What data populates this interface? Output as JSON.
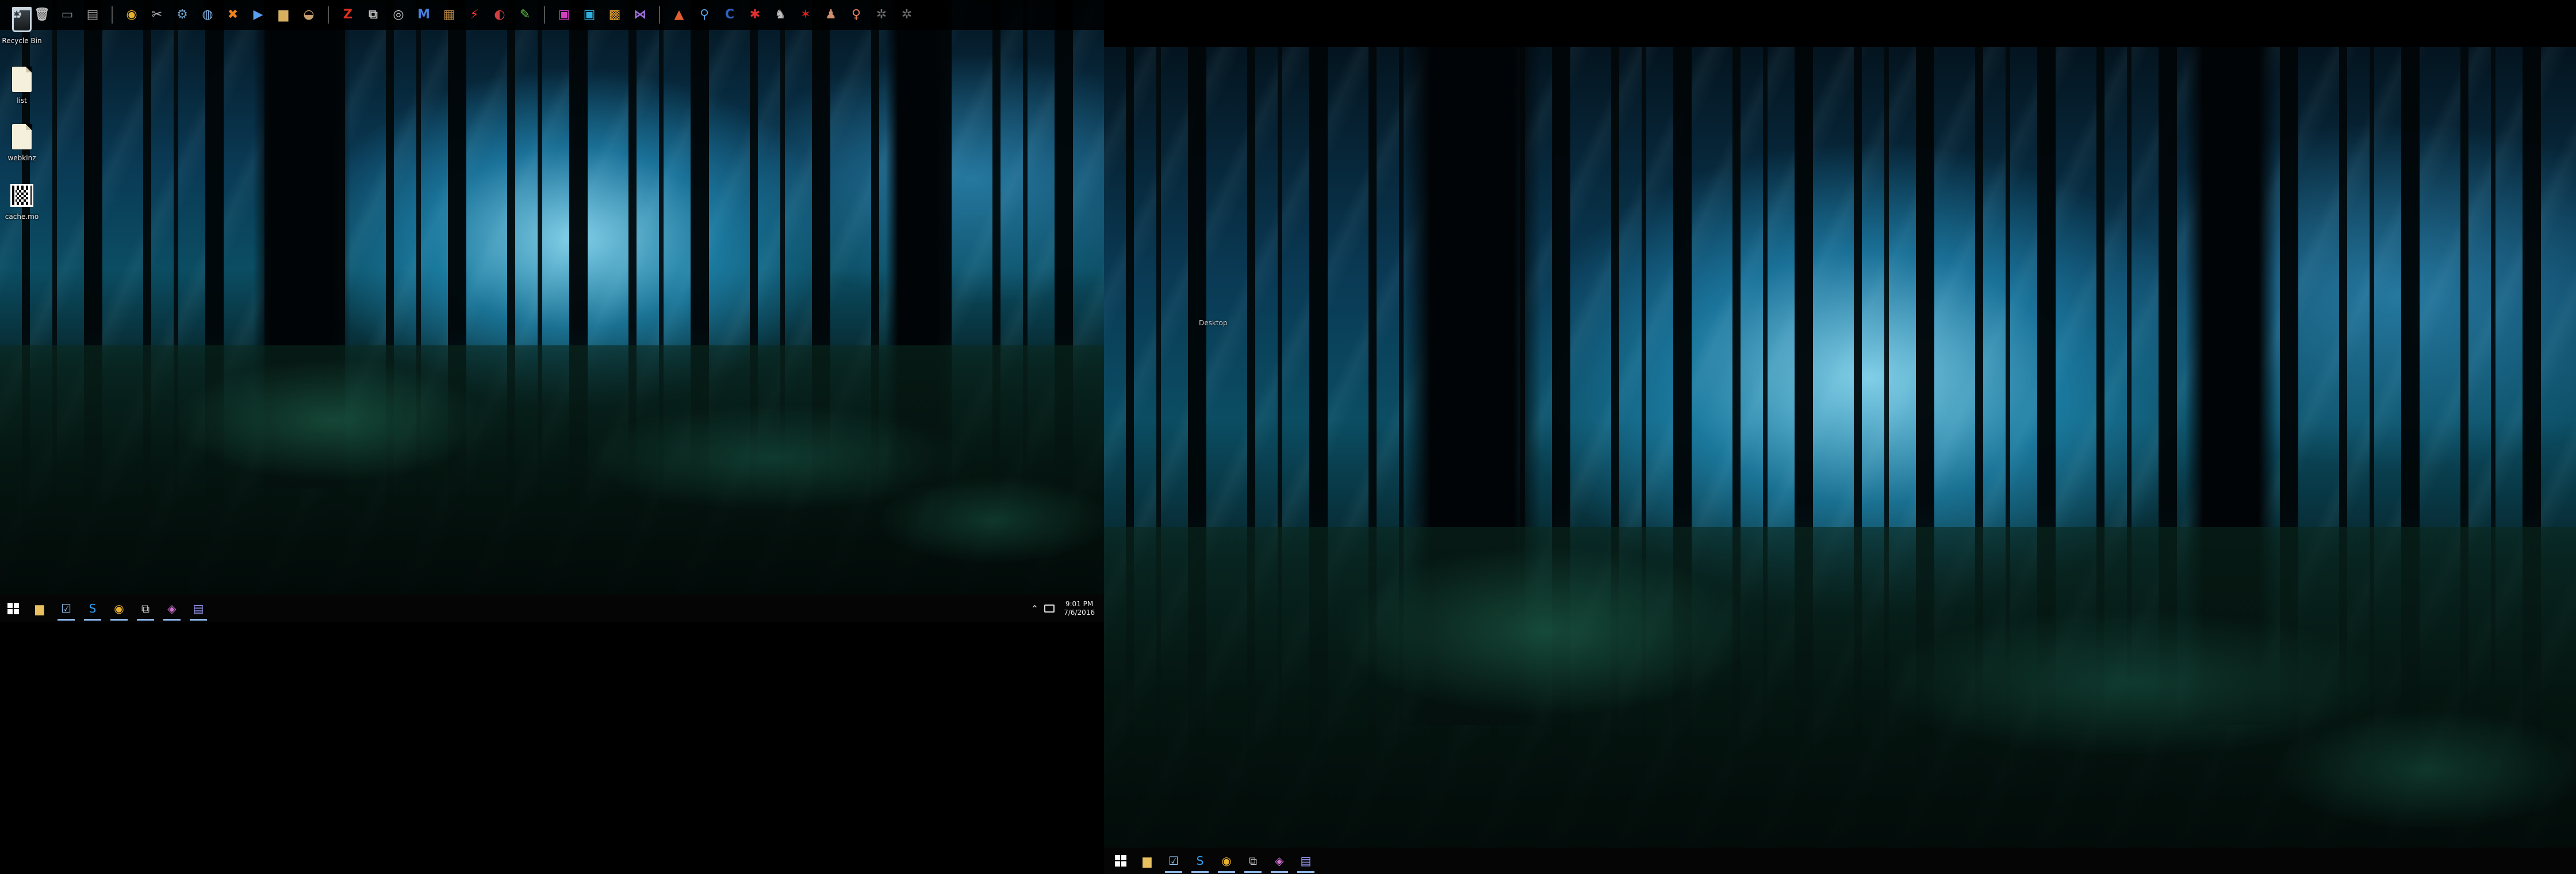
{
  "desktop": {
    "icons": [
      {
        "name": "recycle-bin-icon",
        "label": "Recycle Bin",
        "type": "recycle"
      },
      {
        "name": "file-icon",
        "label": "list",
        "type": "file"
      },
      {
        "name": "file-icon",
        "label": "webkinz",
        "type": "file"
      },
      {
        "name": "qr-icon",
        "label": "cache.mo",
        "type": "qr"
      }
    ],
    "right_label": "Desktop"
  },
  "quick_toolbar": {
    "groups": [
      [
        {
          "name": "recycle-bin-icon",
          "glyph": "♻",
          "color": "#c9d6e0"
        },
        {
          "name": "trash-icon",
          "glyph": "🗑",
          "color": "#bbbbbb"
        },
        {
          "name": "terminal-icon",
          "glyph": "▭",
          "color": "#888888"
        },
        {
          "name": "window-icon",
          "glyph": "▤",
          "color": "#999999"
        }
      ],
      [
        {
          "name": "chrome-icon",
          "glyph": "◉",
          "color": "#e8b030"
        },
        {
          "name": "scissors-icon",
          "glyph": "✂",
          "color": "#bbbbbb"
        },
        {
          "name": "steam-icon",
          "glyph": "⚙",
          "color": "#6fa0c8"
        },
        {
          "name": "globe-icon",
          "glyph": "◍",
          "color": "#7fb0e0"
        },
        {
          "name": "xampp-icon",
          "glyph": "✖",
          "color": "#f08020"
        },
        {
          "name": "play-icon",
          "glyph": "▶",
          "color": "#5aa0f0"
        },
        {
          "name": "folder-icon",
          "glyph": "▆",
          "color": "#d8b060"
        },
        {
          "name": "helmet-icon",
          "glyph": "◒",
          "color": "#c8a070"
        }
      ],
      [
        {
          "name": "filezilla-icon",
          "glyph": "Z",
          "color": "#e03020"
        },
        {
          "name": "network-icon",
          "glyph": "⧉",
          "color": "#c0c0c0"
        },
        {
          "name": "disk-icon",
          "glyph": "◎",
          "color": "#c8c8c8"
        },
        {
          "name": "malwarebytes-icon",
          "glyph": "M",
          "color": "#4a80e0"
        },
        {
          "name": "archive-icon",
          "glyph": "▦",
          "color": "#b08040"
        },
        {
          "name": "bolt-icon",
          "glyph": "⚡",
          "color": "#f03030"
        },
        {
          "name": "mixer-icon",
          "glyph": "◐",
          "color": "#d04040"
        },
        {
          "name": "notepad-icon",
          "glyph": "✎",
          "color": "#60c040"
        }
      ],
      [
        {
          "name": "phpstorm-icon",
          "glyph": "▣",
          "color": "#d040c0"
        },
        {
          "name": "webstorm-icon",
          "glyph": "▣",
          "color": "#30b0e0"
        },
        {
          "name": "palette-icon",
          "glyph": "▩",
          "color": "#e0a030"
        },
        {
          "name": "visual-studio-icon",
          "glyph": "⋈",
          "color": "#a070e0"
        }
      ],
      [
        {
          "name": "paint-icon",
          "glyph": "▲",
          "color": "#e06030"
        },
        {
          "name": "magnifier-icon",
          "glyph": "⚲",
          "color": "#50a0e0"
        },
        {
          "name": "cursor-icon",
          "glyph": "C",
          "color": "#3060c0"
        },
        {
          "name": "dragon-icon",
          "glyph": "✱",
          "color": "#e03030"
        },
        {
          "name": "warrior-icon",
          "glyph": "♞",
          "color": "#c0c0c0"
        },
        {
          "name": "sprite-icon",
          "glyph": "✶",
          "color": "#e02020"
        },
        {
          "name": "character-icon",
          "glyph": "♟",
          "color": "#d09070"
        },
        {
          "name": "girl-icon",
          "glyph": "♀",
          "color": "#e08060"
        },
        {
          "name": "bug-icon",
          "glyph": "✲",
          "color": "#707070"
        },
        {
          "name": "bug-icon",
          "glyph": "✲",
          "color": "#707070"
        }
      ]
    ]
  },
  "taskbar_left": {
    "apps": [
      {
        "name": "file-explorer-icon",
        "glyph": "▆",
        "color": "#e8c060",
        "running": false
      },
      {
        "name": "task-manager-icon",
        "glyph": "☑",
        "color": "#8fc0f0",
        "running": true
      },
      {
        "name": "skype-icon",
        "glyph": "S",
        "color": "#30a0f0",
        "running": true
      },
      {
        "name": "chrome-icon",
        "glyph": "◉",
        "color": "#e8b030",
        "running": true
      },
      {
        "name": "network-tool-icon",
        "glyph": "⧉",
        "color": "#c0c0c0",
        "running": true
      },
      {
        "name": "app-icon",
        "glyph": "◈",
        "color": "#d070d0",
        "running": true
      },
      {
        "name": "notepad-icon",
        "glyph": "▤",
        "color": "#a0a0ff",
        "running": true
      }
    ],
    "clock_time": "9:01 PM",
    "clock_date": "7/6/2016"
  },
  "taskbar_right": {
    "apps": [
      {
        "name": "file-explorer-icon",
        "glyph": "▆",
        "color": "#e8c060",
        "running": false
      },
      {
        "name": "task-manager-icon",
        "glyph": "☑",
        "color": "#8fc0f0",
        "running": true
      },
      {
        "name": "skype-icon",
        "glyph": "S",
        "color": "#30a0f0",
        "running": true
      },
      {
        "name": "chrome-icon",
        "glyph": "◉",
        "color": "#e8b030",
        "running": true
      },
      {
        "name": "network-tool-icon",
        "glyph": "⧉",
        "color": "#c0c0c0",
        "running": true
      },
      {
        "name": "app-icon",
        "glyph": "◈",
        "color": "#d070d0",
        "running": true
      },
      {
        "name": "notepad-icon",
        "glyph": "▤",
        "color": "#a0a0ff",
        "running": true
      }
    ]
  }
}
